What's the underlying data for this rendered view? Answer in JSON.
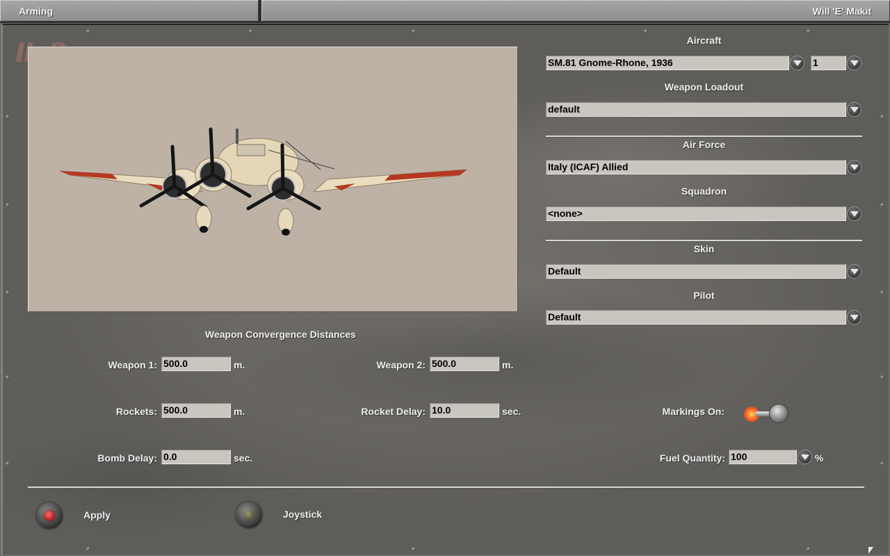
{
  "titlebar": {
    "left": "Arming",
    "right": "Will 'E' Makit"
  },
  "logo": {
    "text": "IL-2"
  },
  "preview": {
    "description_icon": "sm81-aircraft-3d-model"
  },
  "aircraft": {
    "label": "Aircraft",
    "value": "SM.81 Gnome-Rhone, 1936",
    "count": "1"
  },
  "loadout": {
    "label": "Weapon Loadout",
    "value": "default"
  },
  "air_force": {
    "label": "Air Force",
    "value": "Italy (ICAF) Allied"
  },
  "squadron": {
    "label": "Squadron",
    "value": "<none>"
  },
  "skin": {
    "label": "Skin",
    "value": "Default"
  },
  "pilot": {
    "label": "Pilot",
    "value": "Default"
  },
  "convergence": {
    "title": "Weapon Convergence Distances",
    "weapon1": {
      "label": "Weapon 1:",
      "value": "500.0",
      "unit": "m."
    },
    "weapon2": {
      "label": "Weapon 2:",
      "value": "500.0",
      "unit": "m."
    },
    "rockets": {
      "label": "Rockets:",
      "value": "500.0",
      "unit": "m."
    },
    "rocket_delay": {
      "label": "Rocket Delay:",
      "value": "10.0",
      "unit": "sec."
    },
    "bomb_delay": {
      "label": "Bomb Delay:",
      "value": "0.0",
      "unit": "sec."
    }
  },
  "markings": {
    "label": "Markings On:",
    "on": true
  },
  "fuel": {
    "label": "Fuel Quantity:",
    "value": "100",
    "unit": "%"
  },
  "buttons": {
    "apply": "Apply",
    "joystick": "Joystick"
  },
  "colors": {
    "panel": "#6f6d68",
    "field": "#c9c6c0",
    "viewport": "#bdb2a5",
    "lamp_red": "#d00000"
  }
}
